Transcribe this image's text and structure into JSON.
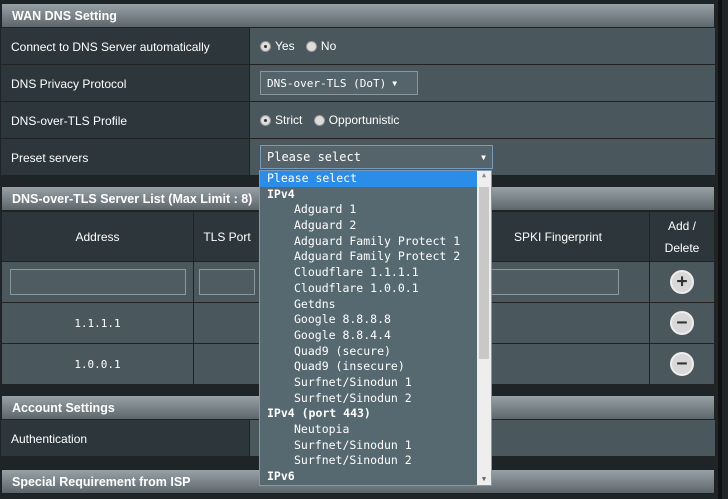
{
  "wan_dns": {
    "title": "WAN DNS Setting",
    "auto_label": "Connect to DNS Server automatically",
    "yes": "Yes",
    "no": "No",
    "protocol_label": "DNS Privacy Protocol",
    "protocol_value": "DNS-over-TLS (DoT)",
    "profile_label": "DNS-over-TLS Profile",
    "strict": "Strict",
    "opportunistic": "Opportunistic",
    "preset_label": "Preset servers",
    "preset_value": "Please select"
  },
  "server_list": {
    "title": "DNS-over-TLS Server List (Max Limit : 8)",
    "headers": {
      "address": "Address",
      "port": "TLS Port",
      "spki": "SPKI Fingerprint",
      "add_delete": "Add / Delete"
    },
    "rows": [
      {
        "address": "1.1.1.1"
      },
      {
        "address": "1.0.0.1"
      }
    ]
  },
  "account": {
    "title": "Account Settings",
    "auth_label": "Authentication"
  },
  "isp": {
    "title": "Special Requirement from ISP"
  },
  "dropdown": {
    "options": [
      {
        "label": "Please select",
        "type": "selected"
      },
      {
        "label": "IPv4",
        "type": "group"
      },
      {
        "label": "Adguard 1",
        "type": "item"
      },
      {
        "label": "Adguard 2",
        "type": "item"
      },
      {
        "label": "Adguard Family Protect 1",
        "type": "item"
      },
      {
        "label": "Adguard Family Protect 2",
        "type": "item"
      },
      {
        "label": "Cloudflare 1.1.1.1",
        "type": "item"
      },
      {
        "label": "Cloudflare 1.0.0.1",
        "type": "item"
      },
      {
        "label": "Getdns",
        "type": "item"
      },
      {
        "label": "Google 8.8.8.8",
        "type": "item"
      },
      {
        "label": "Google 8.8.4.4",
        "type": "item"
      },
      {
        "label": "Quad9 (secure)",
        "type": "item"
      },
      {
        "label": "Quad9 (insecure)",
        "type": "item"
      },
      {
        "label": "Surfnet/Sinodun 1",
        "type": "item"
      },
      {
        "label": "Surfnet/Sinodun 2",
        "type": "item"
      },
      {
        "label": "IPv4 (port 443)",
        "type": "group"
      },
      {
        "label": "Neutopia",
        "type": "item"
      },
      {
        "label": "Surfnet/Sinodun 1",
        "type": "item"
      },
      {
        "label": "Surfnet/Sinodun 2",
        "type": "item"
      },
      {
        "label": "IPv6",
        "type": "group"
      }
    ]
  },
  "colors": {
    "highlight": "#2b8de8"
  }
}
